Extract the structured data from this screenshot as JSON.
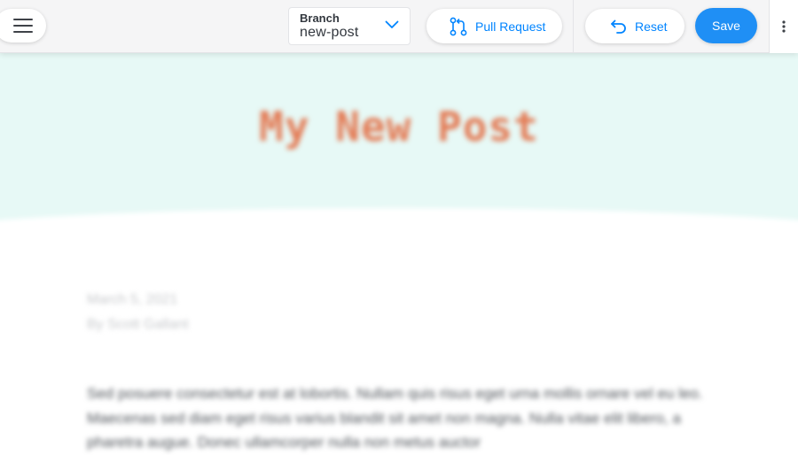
{
  "toolbar": {
    "menu_icon": "hamburger-menu-icon",
    "branch": {
      "label": "Branch",
      "value": "new-post",
      "chevron_icon": "chevron-down-icon"
    },
    "pull_request": {
      "label": "Pull Request",
      "icon": "git-pull-request-icon"
    },
    "reset": {
      "label": "Reset",
      "icon": "undo-arrow-icon"
    },
    "save": {
      "label": "Save"
    },
    "more_icon": "vertical-ellipsis-icon"
  },
  "post": {
    "title": "My New Post",
    "date": "March 5, 2021",
    "author": "By Scott Gallant",
    "body": "Sed posuere consectetur est at lobortis. Nullam quis risus eget urna mollis ornare vel eu leo. Maecenas sed diam eget risus varius blandit sit amet non magna. Nulla vitae elit libero, a pharetra augue. Donec ullamcorper nulla non metus auctor"
  },
  "colors": {
    "accent": "#1f8ff5",
    "link_blue": "#0084ff",
    "hero_bg": "#e7f9f6",
    "title_color": "#e37b55"
  }
}
